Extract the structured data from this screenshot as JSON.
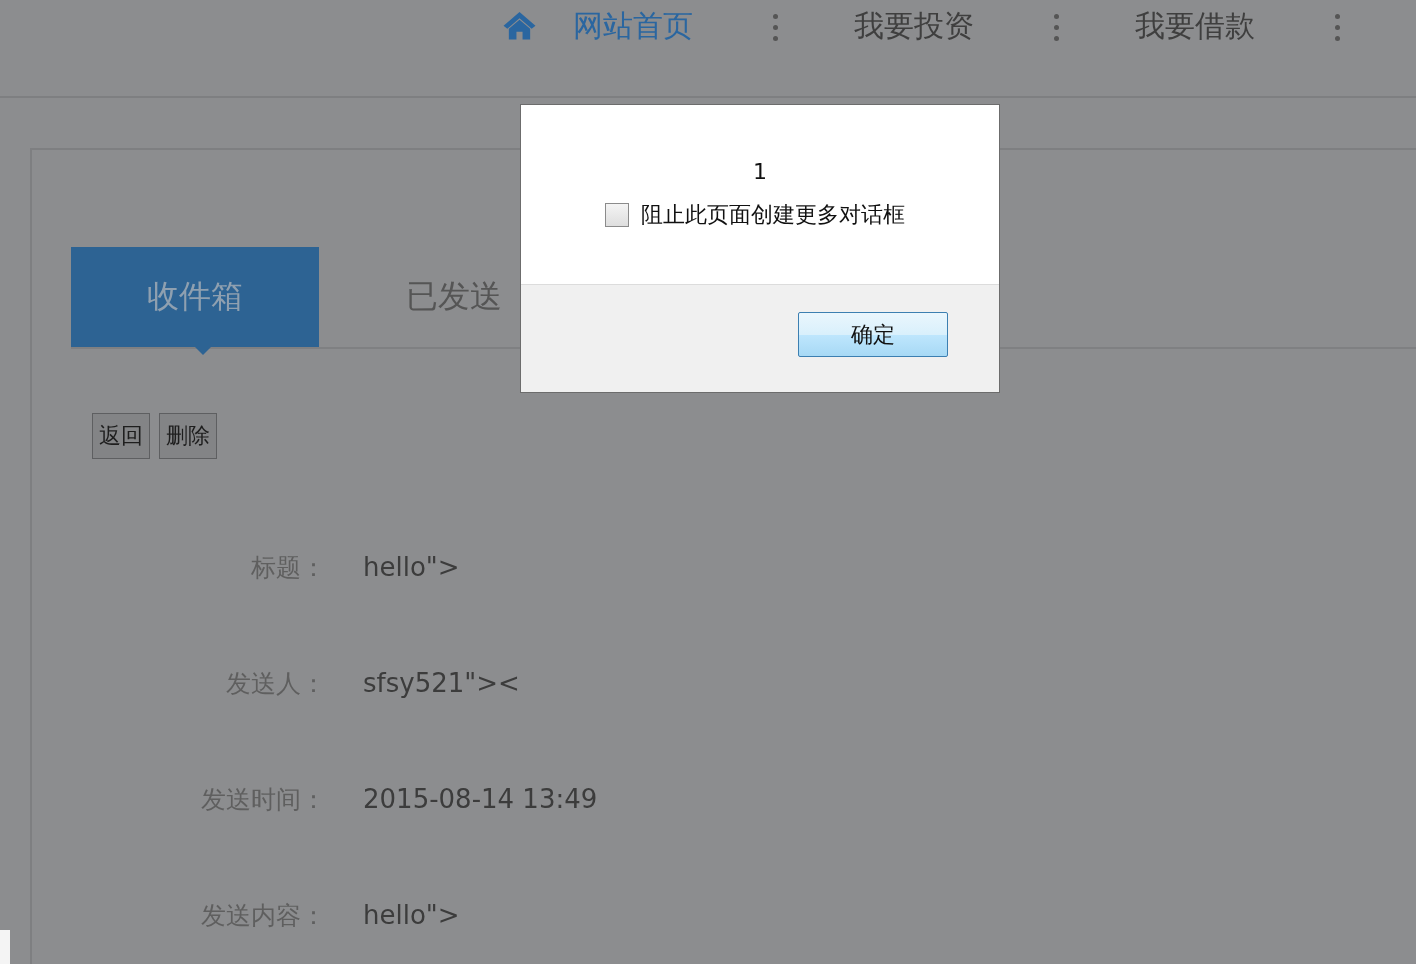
{
  "nav": {
    "items": [
      {
        "label": "网站首页",
        "selected": true
      },
      {
        "label": "我要投资",
        "selected": false
      },
      {
        "label": "我要借款",
        "selected": false
      }
    ]
  },
  "tabs": [
    {
      "label": "收件箱",
      "selected": true
    },
    {
      "label": "已发送",
      "selected": false
    }
  ],
  "actions": [
    "返回",
    "删除"
  ],
  "fields": [
    {
      "label": "标题：",
      "value": "hello\">"
    },
    {
      "label": "发送人：",
      "value": "sfsy521\"><"
    },
    {
      "label": "发送时间：",
      "value": "2015-08-14 13:49"
    },
    {
      "label": "发送内容：",
      "value": "hello\">"
    }
  ],
  "dialog": {
    "message": "1",
    "checkbox": {
      "label": "阻止此页面创建更多对话框",
      "checked": false
    },
    "button": "确定"
  }
}
